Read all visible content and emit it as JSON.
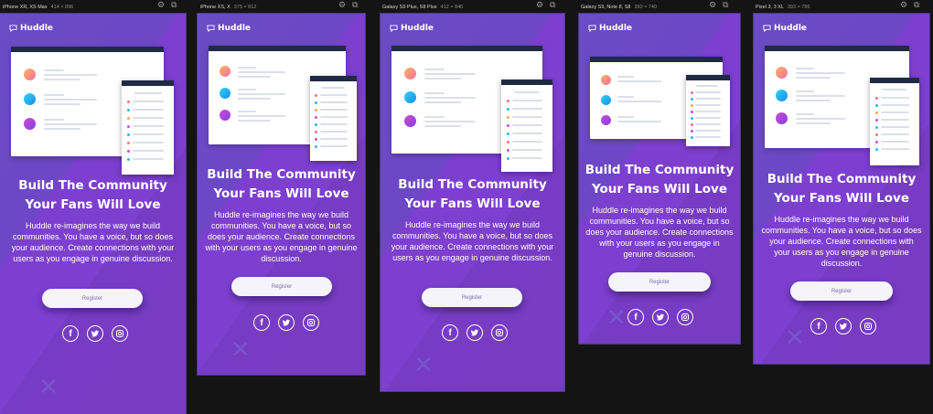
{
  "brand": {
    "logo_text": "Huddle",
    "bg": "#6b4ac1",
    "accent": "#1f2a44"
  },
  "devices": [
    {
      "name": "iPhone XR, XS Max",
      "dims": "414 × 896"
    },
    {
      "name": "iPhone XS, X",
      "dims": "375 × 812"
    },
    {
      "name": "Galaxy S9 Plus, S8 Plus",
      "dims": "412 × 846"
    },
    {
      "name": "Galaxy S9, Note 8, S8",
      "dims": "360 × 740"
    },
    {
      "name": "Pixel 3, 3 XL",
      "dims": "393 × 786"
    }
  ],
  "headline_1": "Build The Community",
  "headline_2": "Your Fans Will Love",
  "description": "Huddle re-imagines the way we build communities. You have a voice, but so does your audience. Create connections with your users as you engage in genuine discussion.",
  "register_label": "Register",
  "social_icons": [
    "facebook-icon",
    "twitter-icon",
    "instagram-icon"
  ],
  "toolbar_icons": [
    "gear-icon",
    "camera-icon"
  ]
}
